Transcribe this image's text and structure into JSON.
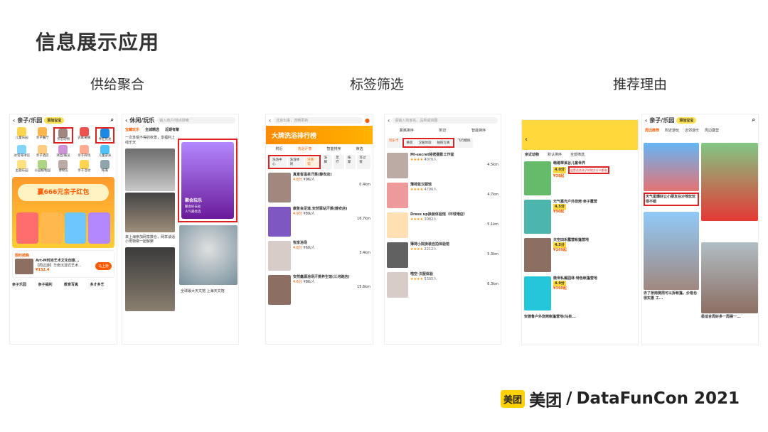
{
  "title": "信息展示应用",
  "sections": [
    "供给聚合",
    "标签筛选",
    "推荐理由"
  ],
  "p1": {
    "header": "亲子/乐园",
    "baby_chip": "添加宝宝",
    "icons": [
      "儿童乐园",
      "亲子餐厅",
      "亲近动物",
      "农家采摘",
      "寻娃拖池",
      "冰雪海洋馆",
      "亲子酒店",
      "演出/展览",
      "亲子商场",
      "儿童游泳",
      "主题乐园",
      "公园植物园",
      "博物馆",
      "亲子活动",
      "帐篷"
    ],
    "banner_text": "赢666元亲子红包",
    "ticket_label": "限时抢购",
    "ticket_title": "Art-M时尚艺术文化创意...",
    "ticket_sub": "【周边游】华南沉浸式艺术...",
    "ticket_price": "¥152.4",
    "ticket_btn": "马上抢",
    "bottom": [
      "亲子乐园",
      "亲子福利",
      "教育写真",
      "多才多艺"
    ]
  },
  "p2": {
    "header": "休闲/玩乐",
    "search_placeholder": "输入商户/地点搜索",
    "tabs": [
      "宝藏玩乐",
      "全城精选",
      "近期有聚"
    ],
    "item1": "一次享受不得的秋景，享福利上线乐天",
    "item2": "来上海参加网享数仓，网享谈话 小宠物做一起解聚",
    "card_title": "聚会玩乐",
    "card_sub": "聚会好去处",
    "card_sub2": "人气最优选",
    "item3": "全球最大天文馆 上海天文馆"
  },
  "p3": {
    "search_placeholder": "北京出来，流畅更新",
    "banner": "大牌洗浴排行榜",
    "filters": [
      "附近",
      "洗浴汗蒸",
      "智能排序",
      "筛选"
    ],
    "tags": [
      "洗浴中心",
      "洗浴休闲",
      "汗蒸馆",
      "洗脚",
      "足疗",
      "按摩",
      "可过夜"
    ],
    "items": [
      {
        "name": "真意客温泉汗蒸(静安店)",
        "score": "4.8分",
        "price": "¥96/人",
        "dist": "0.4km"
      },
      {
        "name": "康复会足道.安然驿站汗蒸(静安店)",
        "score": "4.9分",
        "price": "¥89/人",
        "dist": "16.7km"
      },
      {
        "name": "悦享浴场",
        "score": "4.8分",
        "price": "¥60/人",
        "dist": "3.4km"
      },
      {
        "name": "安然鑫源浴场汗蒸养生馆(三河路店)",
        "score": "4.6分",
        "price": "¥86/人",
        "dist": "15.6km"
      }
    ]
  },
  "p4": {
    "search_placeholder": "请输入商家名、品类或商圈",
    "filters": [
      "距离排序",
      "附近",
      "智能排序"
    ],
    "tags": [
      "玩乐卡",
      "换装",
      "汉服体验",
      "拍照写真",
      "民国风",
      "飞行模拟"
    ],
    "items": [
      {
        "name": "MI-secret秘密摄影工作室",
        "reviews": "4076人",
        "dist": "4.5km"
      },
      {
        "name": "薄荷蓝汉服馆",
        "reviews": "4796人",
        "dist": "4.7km"
      },
      {
        "name": "Dress up换装体验馆（环球港店）",
        "reviews": "3082人",
        "dist": "5.1km"
      },
      {
        "name": "薄荷小院换装自拍体验馆",
        "reviews": "2212人",
        "dist": "5.3km"
      },
      {
        "name": "喵空·汉服体验",
        "reviews": "5305人",
        "dist": "6.3km"
      }
    ]
  },
  "p5": {
    "tabs": [
      "亲近动物",
      "默认排序",
      "全部筛选"
    ],
    "items": [
      {
        "name": "韩建翠溪谷儿童世界",
        "score": "4.0分",
        "reason": "这是适合孩子的地方什么都有",
        "price": "¥38起"
      },
      {
        "name": "元气嘉光户外烧烤·亲子露营",
        "score": "4.5分",
        "price": "¥90起"
      },
      {
        "name": "天空田禾露营帐篷营地",
        "score": "4.5分",
        "price": "¥169起"
      },
      {
        "name": "微世私属园林·特色帐篷营地",
        "score": "4.9分",
        "price": "¥398起"
      },
      {
        "name": "安德鲁户外烧烤帐篷营地(马泉..."
      }
    ]
  },
  "p6": {
    "header": "亲子/乐园",
    "baby_chip": "添加宝宝",
    "tabs": [
      "周边推荐",
      "附近游玩",
      "近郊游乐",
      "周边露营"
    ],
    "reason": "天气星爆好让小朋友在沙地玩玩很不错",
    "card2_title": "去了桥南侧周可以拆帐篷，价格也很实惠 工...",
    "card3_title": "极适合周好多一周展一..."
  },
  "logo": {
    "badge": "美团",
    "name": "美团",
    "slash": "/",
    "event": "DataFunCon 2021"
  }
}
